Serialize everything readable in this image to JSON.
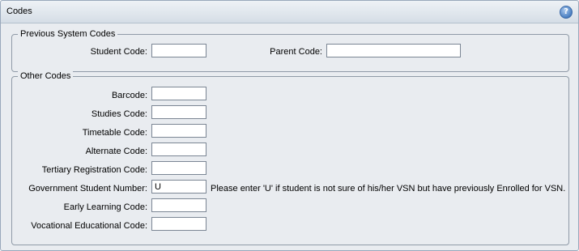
{
  "panel": {
    "title": "Codes",
    "help_icon": "help-icon"
  },
  "previous_system_codes": {
    "legend": "Previous System Codes",
    "student_code": {
      "label": "Student Code:",
      "value": ""
    },
    "parent_code": {
      "label": "Parent Code:",
      "value": ""
    }
  },
  "other_codes": {
    "legend": "Other Codes",
    "fields": [
      {
        "label": "Barcode:",
        "value": ""
      },
      {
        "label": "Studies Code:",
        "value": ""
      },
      {
        "label": "Timetable Code:",
        "value": ""
      },
      {
        "label": "Alternate Code:",
        "value": ""
      },
      {
        "label": "Tertiary Registration Code:",
        "value": ""
      },
      {
        "label": "Government Student Number:",
        "value": "U",
        "note": "Please enter 'U' if student is not sure of his/her VSN but have previously Enrolled for VSN."
      },
      {
        "label": "Early Learning Code:",
        "value": ""
      },
      {
        "label": "Vocational Educational Code:",
        "value": ""
      }
    ]
  }
}
